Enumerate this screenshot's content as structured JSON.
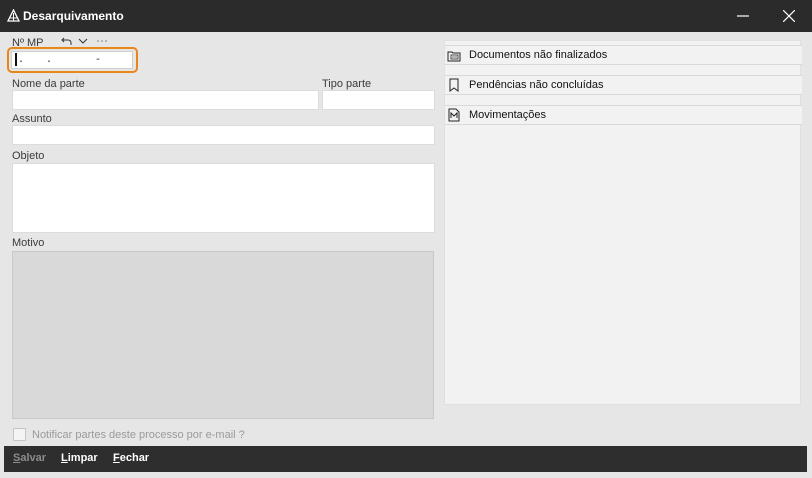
{
  "window": {
    "title": "Desarquivamento"
  },
  "form": {
    "mp_label": "Nº MP",
    "mp_value": ".   .      -",
    "nome_parte_label": "Nome da parte",
    "nome_parte_value": "",
    "tipo_parte_label": "Tipo parte",
    "tipo_parte_value": "",
    "assunto_label": "Assunto",
    "assunto_value": "",
    "objeto_label": "Objeto",
    "objeto_value": "",
    "motivo_label": "Motivo",
    "motivo_value": ""
  },
  "panel": {
    "items": [
      {
        "label": "Documentos não finalizados",
        "icon": "folder-documents-icon"
      },
      {
        "label": "Pendências não concluídas",
        "icon": "bookmark-icon"
      },
      {
        "label": "Movimentações",
        "icon": "movements-document-icon"
      }
    ]
  },
  "notify": {
    "label": "Notificar partes deste processo por e-mail ?",
    "checked": false
  },
  "footer": {
    "save_first": "S",
    "save_rest": "alvar",
    "clear_first": "L",
    "clear_rest": "impar",
    "close_first": "F",
    "close_rest": "echar"
  },
  "colors": {
    "titlebar": "#2b2b2b",
    "footer": "#2e2e2e",
    "highlight": "#e8861a",
    "background": "#e6e6e6"
  }
}
